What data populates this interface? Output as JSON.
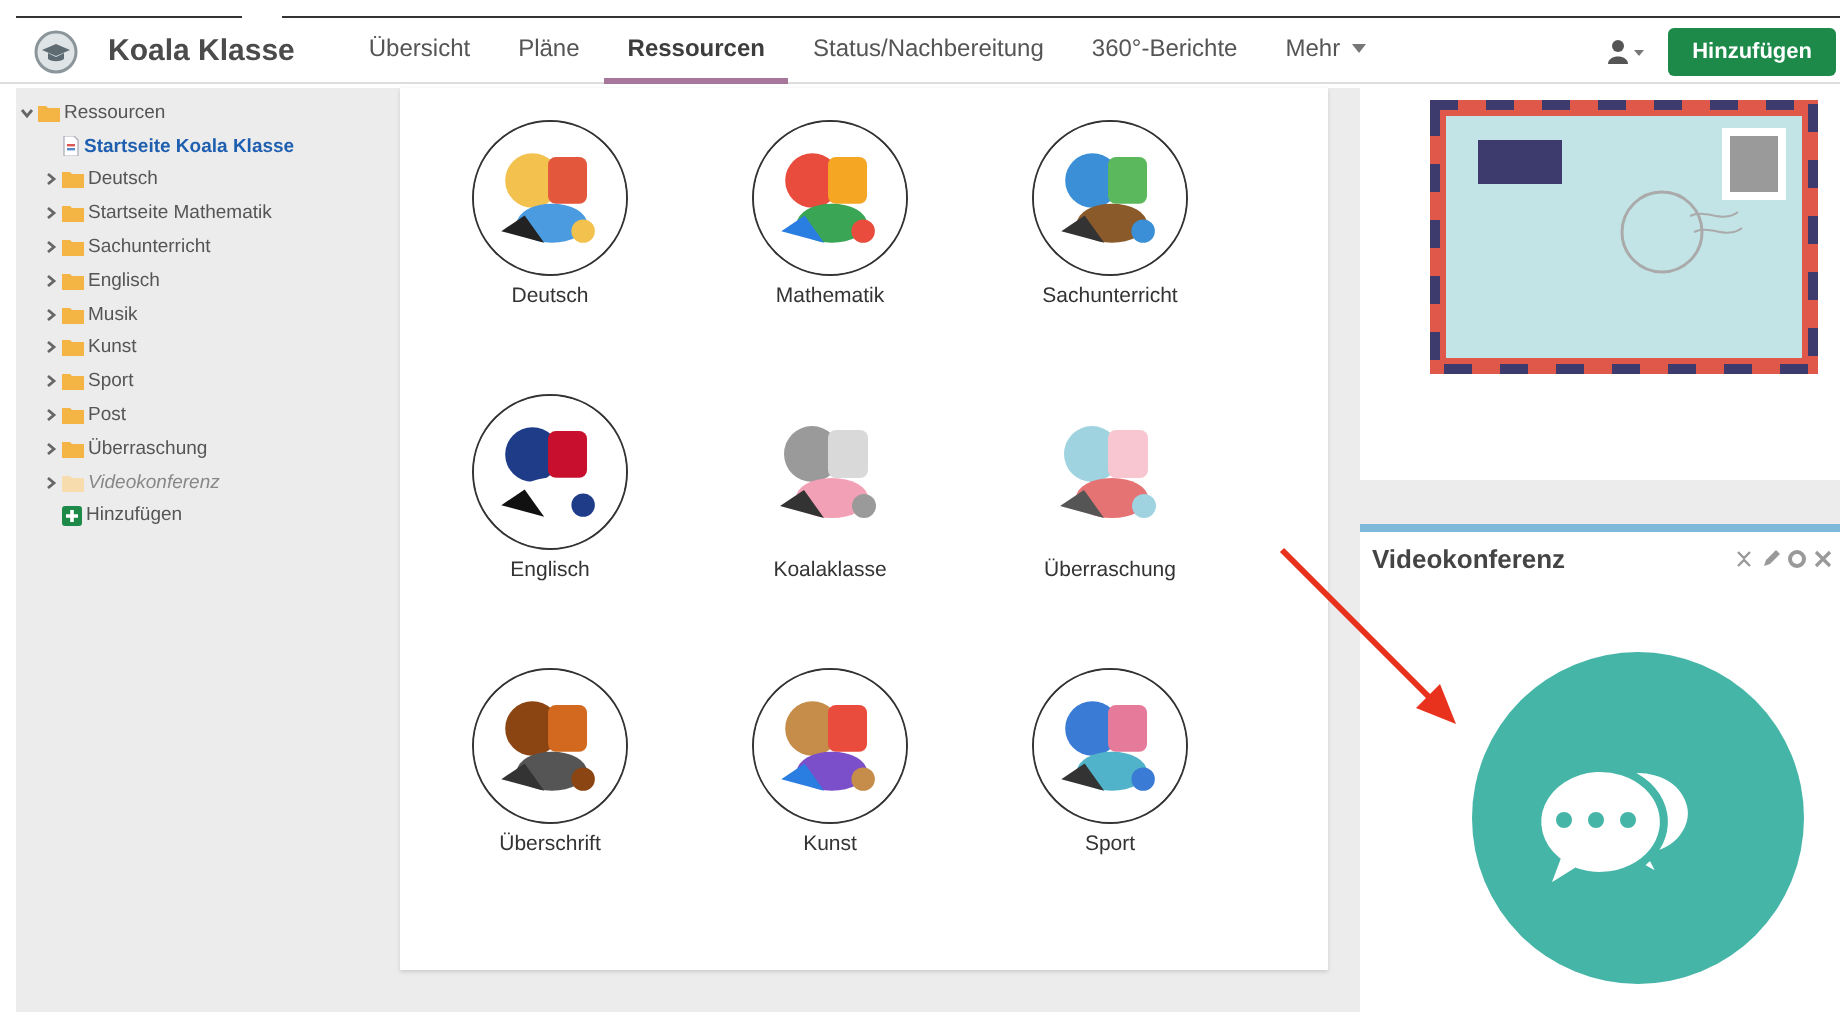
{
  "app": {
    "title": "Koala Klasse"
  },
  "nav": [
    {
      "label": "Übersicht",
      "selected": false
    },
    {
      "label": "Pläne",
      "selected": false
    },
    {
      "label": "Ressourcen",
      "selected": true
    },
    {
      "label": "Status/Nachbereitung",
      "selected": false
    },
    {
      "label": "360°-Berichte",
      "selected": false
    },
    {
      "label": "Mehr",
      "selected": false,
      "kind": "dropdown"
    }
  ],
  "add_button": "Hinzufügen",
  "tree": {
    "label": "Ressourcen",
    "expanded": true,
    "children": [
      {
        "label": "Startseite Koala Klasse",
        "kind": "page",
        "selected": true
      },
      {
        "label": "Deutsch",
        "kind": "folder",
        "expanded": false,
        "muted": false
      },
      {
        "label": "Startseite Mathematik",
        "kind": "folder",
        "expanded": false,
        "muted": false
      },
      {
        "label": "Sachunterricht",
        "kind": "folder",
        "expanded": false,
        "muted": false
      },
      {
        "label": "Englisch",
        "kind": "folder",
        "expanded": false,
        "muted": false
      },
      {
        "label": "Musik",
        "kind": "folder",
        "expanded": false,
        "muted": false
      },
      {
        "label": "Kunst",
        "kind": "folder",
        "expanded": false,
        "muted": false
      },
      {
        "label": "Sport",
        "kind": "folder",
        "expanded": false,
        "muted": false
      },
      {
        "label": "Post",
        "kind": "folder",
        "expanded": false,
        "muted": false
      },
      {
        "label": "Überraschung",
        "kind": "folder",
        "expanded": false,
        "muted": false
      },
      {
        "label": "Videokonferenz",
        "kind": "folder",
        "expanded": false,
        "muted": true
      },
      {
        "label": "Hinzufügen",
        "kind": "add"
      }
    ]
  },
  "tiles": [
    {
      "label": "Deutsch",
      "framed": true
    },
    {
      "label": "Mathematik",
      "framed": true
    },
    {
      "label": "Sachunterricht",
      "framed": true
    },
    {
      "label": "Englisch",
      "framed": true
    },
    {
      "label": "Koalaklasse",
      "framed": false
    },
    {
      "label": "Überraschung",
      "framed": false
    },
    {
      "label": "Überschrift",
      "framed": true
    },
    {
      "label": "Kunst",
      "framed": true
    },
    {
      "label": "Sport",
      "framed": true
    }
  ],
  "video_panel": {
    "title": "Videokonferenz"
  }
}
